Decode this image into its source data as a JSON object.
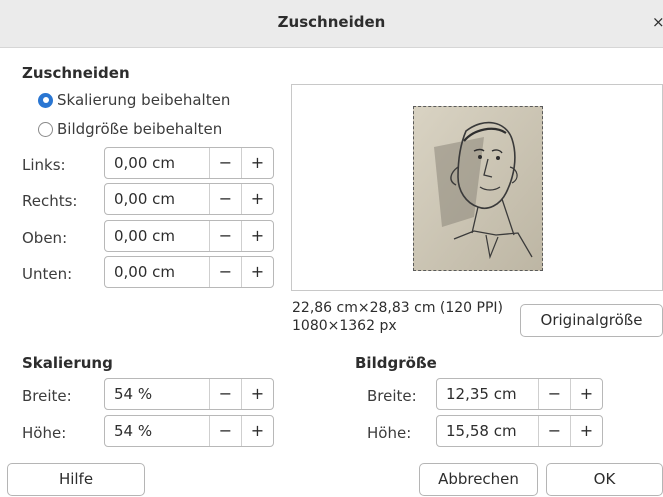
{
  "window": {
    "title": "Zuschneiden",
    "close_glyph": "×"
  },
  "crop": {
    "heading": "Zuschneiden",
    "radio_keep_scale": "Skalierung beibehalten",
    "radio_keep_size": "Bildgröße beibehalten",
    "fields": {
      "left": {
        "label": "Links:",
        "value": "0,00 cm"
      },
      "right": {
        "label": "Rechts:",
        "value": "0,00 cm"
      },
      "top": {
        "label": "Oben:",
        "value": "0,00 cm"
      },
      "bottom": {
        "label": "Unten:",
        "value": "0,00 cm"
      }
    }
  },
  "preview": {
    "size_info": "22,86 cm×28,83 cm (120 PPI)",
    "pixel_info": "1080×1362 px",
    "original_size_button": "Originalgröße"
  },
  "scale": {
    "heading": "Skalierung",
    "width": {
      "label": "Breite:",
      "value": "54 %"
    },
    "height": {
      "label": "Höhe:",
      "value": "54 %"
    }
  },
  "image_size": {
    "heading": "Bildgröße",
    "width": {
      "label": "Breite:",
      "value": "12,35 cm"
    },
    "height": {
      "label": "Höhe:",
      "value": "15,58 cm"
    }
  },
  "buttons": {
    "help": "Hilfe",
    "cancel": "Abbrechen",
    "ok": "OK"
  },
  "spin_glyphs": {
    "minus": "−",
    "plus": "+"
  },
  "colors": {
    "accent": "#2a76d2",
    "titlebar": "#ebebeb"
  }
}
